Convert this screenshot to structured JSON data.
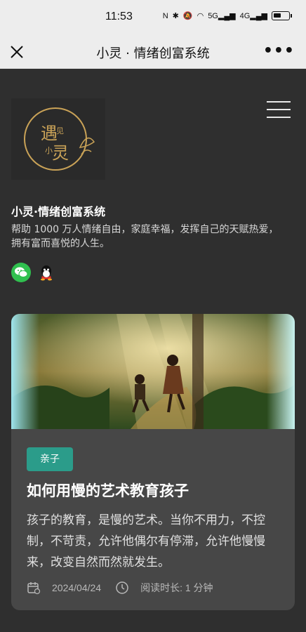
{
  "status_bar": {
    "time": "11:53",
    "network": "5G",
    "network2": "4G"
  },
  "nav": {
    "title": "小灵 · 情绪创富系统",
    "more_label": "•••"
  },
  "header": {
    "logo_text": "遇见小灵",
    "site_title": "小灵·情绪创富系统",
    "description": "帮助 1000 万人情绪自由，家庭幸福，发挥自己的天赋热爱，拥有富而喜悦的人生。"
  },
  "social": {
    "items": [
      "wechat-icon",
      "qq-icon"
    ]
  },
  "article": {
    "tag": "亲子",
    "title": "如何用慢的艺术教育孩子",
    "excerpt": "孩子的教育，是慢的艺术。当你不用力，不控制，不苛责，允许他偶尔有停滞，允许他慢慢来，改变自然而然就发生。",
    "date": "2024/04/24",
    "read_time": "阅读时长: 1 分钟"
  },
  "colors": {
    "background": "#2f2f2f",
    "card": "#474747",
    "tag": "#2b9c8a",
    "wechat": "#30c04f"
  }
}
